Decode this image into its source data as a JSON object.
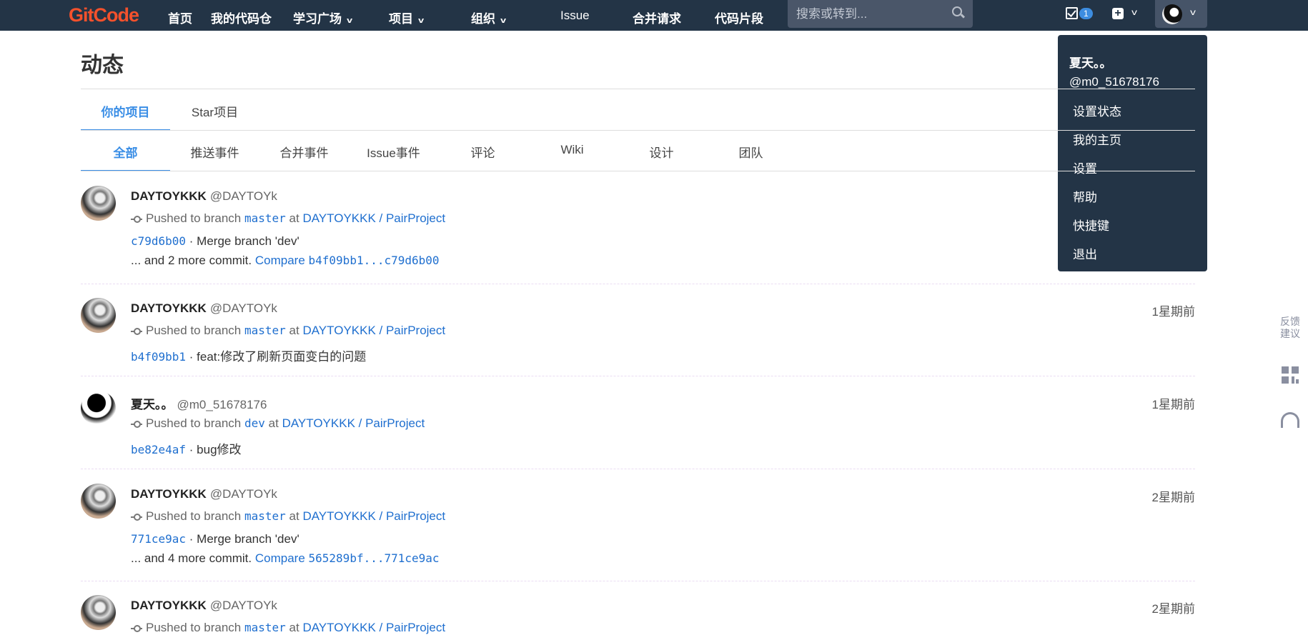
{
  "nav": {
    "logo": "GitCode",
    "items": [
      {
        "label": "首页"
      },
      {
        "label": "我的代码仓"
      },
      {
        "label": "学习广场",
        "dropdown": true
      },
      {
        "label": "项目",
        "dropdown": true
      },
      {
        "label": "组织",
        "dropdown": true
      },
      {
        "label": "Issue"
      },
      {
        "label": "合并请求"
      },
      {
        "label": "代码片段"
      }
    ],
    "search_placeholder": "搜索或转到...",
    "todo_count": "1"
  },
  "user_menu": {
    "name": "夏天。。",
    "handle": "@m0_51678176",
    "items": [
      "设置状态",
      "我的主页",
      "设置",
      "帮助",
      "快捷键",
      "退出"
    ]
  },
  "page": {
    "title": "动态",
    "tabs": [
      "你的项目",
      "Star项目"
    ],
    "filters": [
      "全部",
      "推送事件",
      "合并事件",
      "Issue事件",
      "评论",
      "Wiki",
      "设计",
      "团队"
    ]
  },
  "events": [
    {
      "avatar": "cat",
      "name": "DAYTOYKKK",
      "handle": "@DAYTOYk",
      "action": "Pushed to branch",
      "branch": "master",
      "at": "at",
      "project": "DAYTOYKKK / PairProject",
      "time": "",
      "commit": "c79d6b00",
      "message": "Merge branch 'dev'",
      "more": "... and 2 more commit.",
      "compare_label": "Compare",
      "compare": "b4f09bb1...c79d6b00"
    },
    {
      "avatar": "cat",
      "name": "DAYTOYKKK",
      "handle": "@DAYTOYk",
      "action": "Pushed to branch",
      "branch": "master",
      "at": "at",
      "project": "DAYTOYKKK / PairProject",
      "time": "1星期前",
      "commit": "b4f09bb1",
      "message": "feat:修改了刷新页面变白的问题"
    },
    {
      "avatar": "boy",
      "name": "夏天。。",
      "handle": "@m0_51678176",
      "action": "Pushed to branch",
      "branch": "dev",
      "at": "at",
      "project": "DAYTOYKKK / PairProject",
      "time": "1星期前",
      "commit": "be82e4af",
      "message": "bug修改"
    },
    {
      "avatar": "cat",
      "name": "DAYTOYKKK",
      "handle": "@DAYTOYk",
      "action": "Pushed to branch",
      "branch": "master",
      "at": "at",
      "project": "DAYTOYKKK / PairProject",
      "time": "2星期前",
      "commit": "771ce9ac",
      "message": "Merge branch 'dev'",
      "more": "... and 4 more commit.",
      "compare_label": "Compare",
      "compare": "565289bf...771ce9ac"
    },
    {
      "avatar": "cat",
      "name": "DAYTOYKKK",
      "handle": "@DAYTOYk",
      "action": "Pushed to branch",
      "branch": "master",
      "at": "at",
      "project": "DAYTOYKKK / PairProject",
      "time": "2星期前"
    }
  ],
  "side": {
    "feedback": "反馈建议"
  }
}
